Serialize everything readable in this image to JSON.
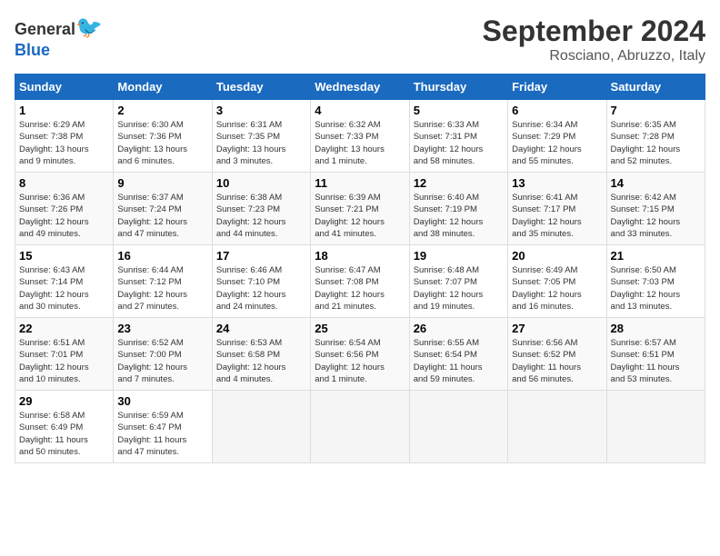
{
  "logo": {
    "general": "General",
    "blue": "Blue"
  },
  "title": "September 2024",
  "location": "Rosciano, Abruzzo, Italy",
  "days_header": [
    "Sunday",
    "Monday",
    "Tuesday",
    "Wednesday",
    "Thursday",
    "Friday",
    "Saturday"
  ],
  "weeks": [
    [
      {
        "num": "1",
        "info": "Sunrise: 6:29 AM\nSunset: 7:38 PM\nDaylight: 13 hours\nand 9 minutes."
      },
      {
        "num": "2",
        "info": "Sunrise: 6:30 AM\nSunset: 7:36 PM\nDaylight: 13 hours\nand 6 minutes."
      },
      {
        "num": "3",
        "info": "Sunrise: 6:31 AM\nSunset: 7:35 PM\nDaylight: 13 hours\nand 3 minutes."
      },
      {
        "num": "4",
        "info": "Sunrise: 6:32 AM\nSunset: 7:33 PM\nDaylight: 13 hours\nand 1 minute."
      },
      {
        "num": "5",
        "info": "Sunrise: 6:33 AM\nSunset: 7:31 PM\nDaylight: 12 hours\nand 58 minutes."
      },
      {
        "num": "6",
        "info": "Sunrise: 6:34 AM\nSunset: 7:29 PM\nDaylight: 12 hours\nand 55 minutes."
      },
      {
        "num": "7",
        "info": "Sunrise: 6:35 AM\nSunset: 7:28 PM\nDaylight: 12 hours\nand 52 minutes."
      }
    ],
    [
      {
        "num": "8",
        "info": "Sunrise: 6:36 AM\nSunset: 7:26 PM\nDaylight: 12 hours\nand 49 minutes."
      },
      {
        "num": "9",
        "info": "Sunrise: 6:37 AM\nSunset: 7:24 PM\nDaylight: 12 hours\nand 47 minutes."
      },
      {
        "num": "10",
        "info": "Sunrise: 6:38 AM\nSunset: 7:23 PM\nDaylight: 12 hours\nand 44 minutes."
      },
      {
        "num": "11",
        "info": "Sunrise: 6:39 AM\nSunset: 7:21 PM\nDaylight: 12 hours\nand 41 minutes."
      },
      {
        "num": "12",
        "info": "Sunrise: 6:40 AM\nSunset: 7:19 PM\nDaylight: 12 hours\nand 38 minutes."
      },
      {
        "num": "13",
        "info": "Sunrise: 6:41 AM\nSunset: 7:17 PM\nDaylight: 12 hours\nand 35 minutes."
      },
      {
        "num": "14",
        "info": "Sunrise: 6:42 AM\nSunset: 7:15 PM\nDaylight: 12 hours\nand 33 minutes."
      }
    ],
    [
      {
        "num": "15",
        "info": "Sunrise: 6:43 AM\nSunset: 7:14 PM\nDaylight: 12 hours\nand 30 minutes."
      },
      {
        "num": "16",
        "info": "Sunrise: 6:44 AM\nSunset: 7:12 PM\nDaylight: 12 hours\nand 27 minutes."
      },
      {
        "num": "17",
        "info": "Sunrise: 6:46 AM\nSunset: 7:10 PM\nDaylight: 12 hours\nand 24 minutes."
      },
      {
        "num": "18",
        "info": "Sunrise: 6:47 AM\nSunset: 7:08 PM\nDaylight: 12 hours\nand 21 minutes."
      },
      {
        "num": "19",
        "info": "Sunrise: 6:48 AM\nSunset: 7:07 PM\nDaylight: 12 hours\nand 19 minutes."
      },
      {
        "num": "20",
        "info": "Sunrise: 6:49 AM\nSunset: 7:05 PM\nDaylight: 12 hours\nand 16 minutes."
      },
      {
        "num": "21",
        "info": "Sunrise: 6:50 AM\nSunset: 7:03 PM\nDaylight: 12 hours\nand 13 minutes."
      }
    ],
    [
      {
        "num": "22",
        "info": "Sunrise: 6:51 AM\nSunset: 7:01 PM\nDaylight: 12 hours\nand 10 minutes."
      },
      {
        "num": "23",
        "info": "Sunrise: 6:52 AM\nSunset: 7:00 PM\nDaylight: 12 hours\nand 7 minutes."
      },
      {
        "num": "24",
        "info": "Sunrise: 6:53 AM\nSunset: 6:58 PM\nDaylight: 12 hours\nand 4 minutes."
      },
      {
        "num": "25",
        "info": "Sunrise: 6:54 AM\nSunset: 6:56 PM\nDaylight: 12 hours\nand 1 minute."
      },
      {
        "num": "26",
        "info": "Sunrise: 6:55 AM\nSunset: 6:54 PM\nDaylight: 11 hours\nand 59 minutes."
      },
      {
        "num": "27",
        "info": "Sunrise: 6:56 AM\nSunset: 6:52 PM\nDaylight: 11 hours\nand 56 minutes."
      },
      {
        "num": "28",
        "info": "Sunrise: 6:57 AM\nSunset: 6:51 PM\nDaylight: 11 hours\nand 53 minutes."
      }
    ],
    [
      {
        "num": "29",
        "info": "Sunrise: 6:58 AM\nSunset: 6:49 PM\nDaylight: 11 hours\nand 50 minutes."
      },
      {
        "num": "30",
        "info": "Sunrise: 6:59 AM\nSunset: 6:47 PM\nDaylight: 11 hours\nand 47 minutes."
      },
      {
        "num": "",
        "info": ""
      },
      {
        "num": "",
        "info": ""
      },
      {
        "num": "",
        "info": ""
      },
      {
        "num": "",
        "info": ""
      },
      {
        "num": "",
        "info": ""
      }
    ]
  ]
}
